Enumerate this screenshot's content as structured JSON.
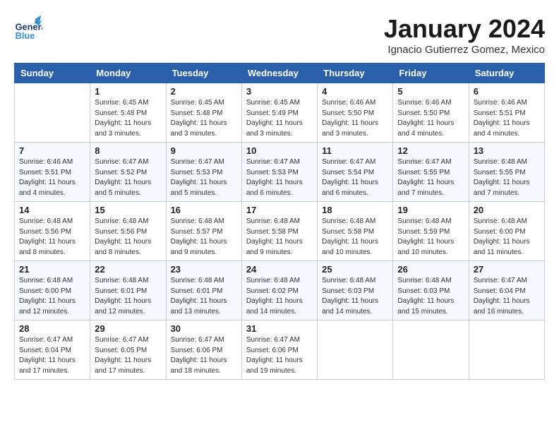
{
  "header": {
    "logo_general": "General",
    "logo_blue": "Blue",
    "month_title": "January 2024",
    "subtitle": "Ignacio Gutierrez Gomez, Mexico"
  },
  "weekdays": [
    "Sunday",
    "Monday",
    "Tuesday",
    "Wednesday",
    "Thursday",
    "Friday",
    "Saturday"
  ],
  "weeks": [
    [
      {
        "day": "",
        "sunrise": "",
        "sunset": "",
        "daylight": ""
      },
      {
        "day": "1",
        "sunrise": "Sunrise: 6:45 AM",
        "sunset": "Sunset: 5:48 PM",
        "daylight": "Daylight: 11 hours and 3 minutes."
      },
      {
        "day": "2",
        "sunrise": "Sunrise: 6:45 AM",
        "sunset": "Sunset: 5:48 PM",
        "daylight": "Daylight: 11 hours and 3 minutes."
      },
      {
        "day": "3",
        "sunrise": "Sunrise: 6:45 AM",
        "sunset": "Sunset: 5:49 PM",
        "daylight": "Daylight: 11 hours and 3 minutes."
      },
      {
        "day": "4",
        "sunrise": "Sunrise: 6:46 AM",
        "sunset": "Sunset: 5:50 PM",
        "daylight": "Daylight: 11 hours and 3 minutes."
      },
      {
        "day": "5",
        "sunrise": "Sunrise: 6:46 AM",
        "sunset": "Sunset: 5:50 PM",
        "daylight": "Daylight: 11 hours and 4 minutes."
      },
      {
        "day": "6",
        "sunrise": "Sunrise: 6:46 AM",
        "sunset": "Sunset: 5:51 PM",
        "daylight": "Daylight: 11 hours and 4 minutes."
      }
    ],
    [
      {
        "day": "7",
        "sunrise": "Sunrise: 6:46 AM",
        "sunset": "Sunset: 5:51 PM",
        "daylight": "Daylight: 11 hours and 4 minutes."
      },
      {
        "day": "8",
        "sunrise": "Sunrise: 6:47 AM",
        "sunset": "Sunset: 5:52 PM",
        "daylight": "Daylight: 11 hours and 5 minutes."
      },
      {
        "day": "9",
        "sunrise": "Sunrise: 6:47 AM",
        "sunset": "Sunset: 5:53 PM",
        "daylight": "Daylight: 11 hours and 5 minutes."
      },
      {
        "day": "10",
        "sunrise": "Sunrise: 6:47 AM",
        "sunset": "Sunset: 5:53 PM",
        "daylight": "Daylight: 11 hours and 6 minutes."
      },
      {
        "day": "11",
        "sunrise": "Sunrise: 6:47 AM",
        "sunset": "Sunset: 5:54 PM",
        "daylight": "Daylight: 11 hours and 6 minutes."
      },
      {
        "day": "12",
        "sunrise": "Sunrise: 6:47 AM",
        "sunset": "Sunset: 5:55 PM",
        "daylight": "Daylight: 11 hours and 7 minutes."
      },
      {
        "day": "13",
        "sunrise": "Sunrise: 6:48 AM",
        "sunset": "Sunset: 5:55 PM",
        "daylight": "Daylight: 11 hours and 7 minutes."
      }
    ],
    [
      {
        "day": "14",
        "sunrise": "Sunrise: 6:48 AM",
        "sunset": "Sunset: 5:56 PM",
        "daylight": "Daylight: 11 hours and 8 minutes."
      },
      {
        "day": "15",
        "sunrise": "Sunrise: 6:48 AM",
        "sunset": "Sunset: 5:56 PM",
        "daylight": "Daylight: 11 hours and 8 minutes."
      },
      {
        "day": "16",
        "sunrise": "Sunrise: 6:48 AM",
        "sunset": "Sunset: 5:57 PM",
        "daylight": "Daylight: 11 hours and 9 minutes."
      },
      {
        "day": "17",
        "sunrise": "Sunrise: 6:48 AM",
        "sunset": "Sunset: 5:58 PM",
        "daylight": "Daylight: 11 hours and 9 minutes."
      },
      {
        "day": "18",
        "sunrise": "Sunrise: 6:48 AM",
        "sunset": "Sunset: 5:58 PM",
        "daylight": "Daylight: 11 hours and 10 minutes."
      },
      {
        "day": "19",
        "sunrise": "Sunrise: 6:48 AM",
        "sunset": "Sunset: 5:59 PM",
        "daylight": "Daylight: 11 hours and 10 minutes."
      },
      {
        "day": "20",
        "sunrise": "Sunrise: 6:48 AM",
        "sunset": "Sunset: 6:00 PM",
        "daylight": "Daylight: 11 hours and 11 minutes."
      }
    ],
    [
      {
        "day": "21",
        "sunrise": "Sunrise: 6:48 AM",
        "sunset": "Sunset: 6:00 PM",
        "daylight": "Daylight: 11 hours and 12 minutes."
      },
      {
        "day": "22",
        "sunrise": "Sunrise: 6:48 AM",
        "sunset": "Sunset: 6:01 PM",
        "daylight": "Daylight: 11 hours and 12 minutes."
      },
      {
        "day": "23",
        "sunrise": "Sunrise: 6:48 AM",
        "sunset": "Sunset: 6:01 PM",
        "daylight": "Daylight: 11 hours and 13 minutes."
      },
      {
        "day": "24",
        "sunrise": "Sunrise: 6:48 AM",
        "sunset": "Sunset: 6:02 PM",
        "daylight": "Daylight: 11 hours and 14 minutes."
      },
      {
        "day": "25",
        "sunrise": "Sunrise: 6:48 AM",
        "sunset": "Sunset: 6:03 PM",
        "daylight": "Daylight: 11 hours and 14 minutes."
      },
      {
        "day": "26",
        "sunrise": "Sunrise: 6:48 AM",
        "sunset": "Sunset: 6:03 PM",
        "daylight": "Daylight: 11 hours and 15 minutes."
      },
      {
        "day": "27",
        "sunrise": "Sunrise: 6:47 AM",
        "sunset": "Sunset: 6:04 PM",
        "daylight": "Daylight: 11 hours and 16 minutes."
      }
    ],
    [
      {
        "day": "28",
        "sunrise": "Sunrise: 6:47 AM",
        "sunset": "Sunset: 6:04 PM",
        "daylight": "Daylight: 11 hours and 17 minutes."
      },
      {
        "day": "29",
        "sunrise": "Sunrise: 6:47 AM",
        "sunset": "Sunset: 6:05 PM",
        "daylight": "Daylight: 11 hours and 17 minutes."
      },
      {
        "day": "30",
        "sunrise": "Sunrise: 6:47 AM",
        "sunset": "Sunset: 6:06 PM",
        "daylight": "Daylight: 11 hours and 18 minutes."
      },
      {
        "day": "31",
        "sunrise": "Sunrise: 6:47 AM",
        "sunset": "Sunset: 6:06 PM",
        "daylight": "Daylight: 11 hours and 19 minutes."
      },
      {
        "day": "",
        "sunrise": "",
        "sunset": "",
        "daylight": ""
      },
      {
        "day": "",
        "sunrise": "",
        "sunset": "",
        "daylight": ""
      },
      {
        "day": "",
        "sunrise": "",
        "sunset": "",
        "daylight": ""
      }
    ]
  ]
}
